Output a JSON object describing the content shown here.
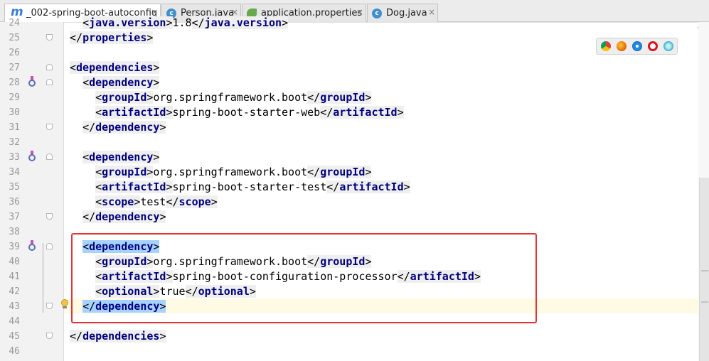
{
  "tabs": [
    {
      "label": "_002-spring-boot-autoconfig",
      "icon": "maven-module-icon",
      "active": true
    },
    {
      "label": "Person.java",
      "icon": "java-class-icon",
      "active": false
    },
    {
      "label": "application.properties",
      "icon": "spring-properties-icon",
      "active": false
    },
    {
      "label": "Dog.java",
      "icon": "java-class-icon",
      "active": false
    }
  ],
  "tab_close_glyph": "×",
  "tab_icon_m": "m",
  "tab_icon_c": "c",
  "status_checkmark": "✓",
  "code": {
    "line_numbers": [
      "24",
      "25",
      "26",
      "27",
      "28",
      "29",
      "30",
      "31",
      "32",
      "33",
      "34",
      "35",
      "36",
      "37",
      "38",
      "39",
      "40",
      "41",
      "42",
      "43",
      "44",
      "45",
      "46"
    ],
    "lines": {
      "l24": {
        "indent": "  ",
        "open": "java.version",
        "text": "1.8",
        "close": "java.version"
      },
      "l25": {
        "indent": "",
        "close": "properties"
      },
      "l27": {
        "indent": "",
        "open": "dependencies"
      },
      "l28": {
        "indent": "  ",
        "open": "dependency"
      },
      "l29": {
        "indent": "    ",
        "open": "groupId",
        "text": "org.springframework.boot",
        "close": "groupId"
      },
      "l30": {
        "indent": "    ",
        "open": "artifactId",
        "text": "spring-boot-starter-web",
        "close": "artifactId"
      },
      "l31": {
        "indent": "  ",
        "close": "dependency"
      },
      "l33": {
        "indent": "  ",
        "open": "dependency"
      },
      "l34": {
        "indent": "    ",
        "open": "groupId",
        "text": "org.springframework.boot",
        "close": "groupId"
      },
      "l35": {
        "indent": "    ",
        "open": "artifactId",
        "text": "spring-boot-starter-test",
        "close": "artifactId"
      },
      "l36": {
        "indent": "    ",
        "open": "scope",
        "text": "test",
        "close": "scope"
      },
      "l37": {
        "indent": "  ",
        "close": "dependency"
      },
      "l39": {
        "indent": "  ",
        "open": "dependency"
      },
      "l40": {
        "indent": "    ",
        "open": "groupId",
        "text": "org.springframework.boot",
        "close": "groupId"
      },
      "l41": {
        "indent": "    ",
        "open": "artifactId",
        "text": "spring-boot-configuration-processor",
        "close": "artifactId"
      },
      "l42": {
        "indent": "    ",
        "open": "optional",
        "text": "true",
        "close": "optional"
      },
      "l43": {
        "indent": "  ",
        "close": "dependency"
      },
      "l45": {
        "indent": "",
        "close": "dependencies"
      }
    }
  },
  "gutter_icons": {
    "maven_dependency_lines": [
      "28",
      "33",
      "39"
    ],
    "intention_bulb_line": "43"
  },
  "browser_icons": [
    "chrome-icon",
    "firefox-icon",
    "safari-icon",
    "opera-icon",
    "ie-icon"
  ],
  "colors": {
    "tag": "#000080",
    "highlight_box": "#e63232",
    "selection": "#a6d2ff",
    "caret_row": "#fffae3"
  }
}
